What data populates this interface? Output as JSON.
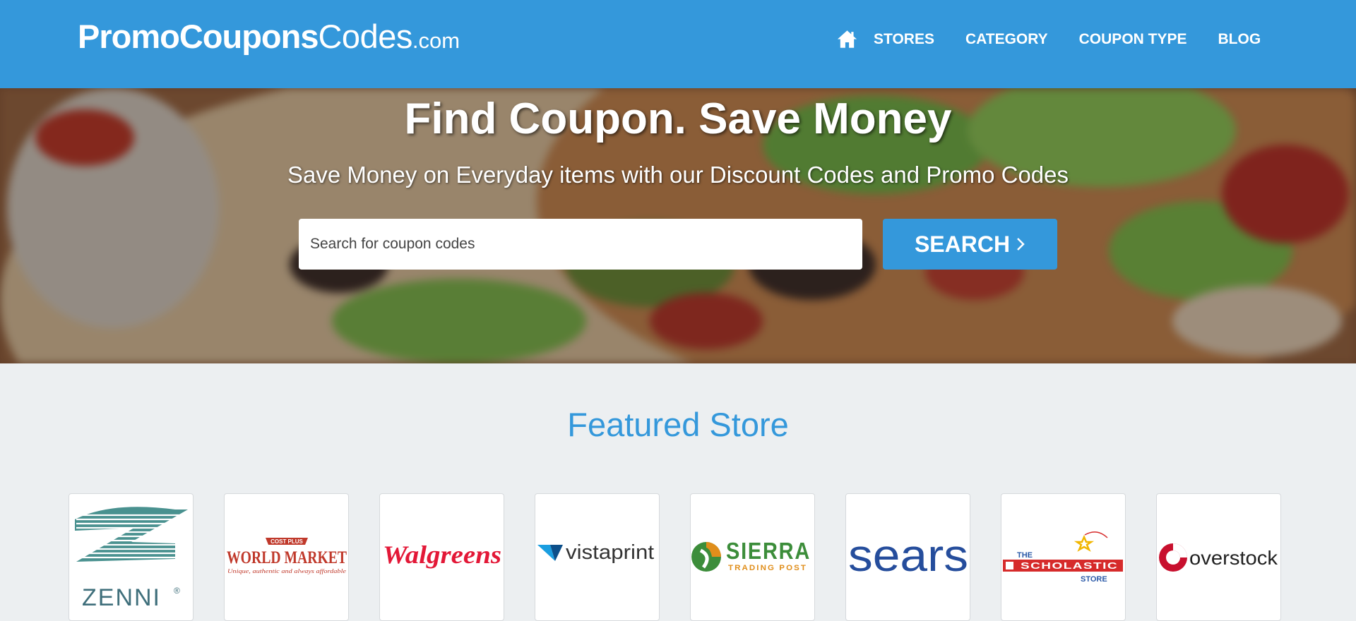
{
  "logo": {
    "bold": "PromoCoupons",
    "light": "Codes",
    "suffix": ".com"
  },
  "nav": {
    "home_icon": "home-icon",
    "items": [
      "STORES",
      "CATEGORY",
      "COUPON TYPE",
      "BLOG"
    ]
  },
  "hero": {
    "title": "Find Coupon. Save Money",
    "subtitle": "Save Money on Everyday items with our Discount Codes and Promo Codes",
    "search_placeholder": "Search for coupon codes",
    "search_label": "SEARCH"
  },
  "featured": {
    "title": "Featured Store",
    "stores": [
      {
        "name": "ZENNI",
        "mark": "®"
      },
      {
        "name": "WORLD MARKET",
        "top": "COST PLUS",
        "tagline": "Unique, authentic and always affordable"
      },
      {
        "name": "Walgreens"
      },
      {
        "name": "vistaprint",
        "mark": "."
      },
      {
        "name": "SIERRA",
        "sub": "TRADING POST"
      },
      {
        "name": "sears"
      },
      {
        "name": "SCHOLASTIC",
        "top": "THE",
        "sub": "STORE"
      },
      {
        "name": "overstock"
      }
    ]
  },
  "colors": {
    "primary": "#3498db",
    "page_bg": "#eceff1"
  }
}
